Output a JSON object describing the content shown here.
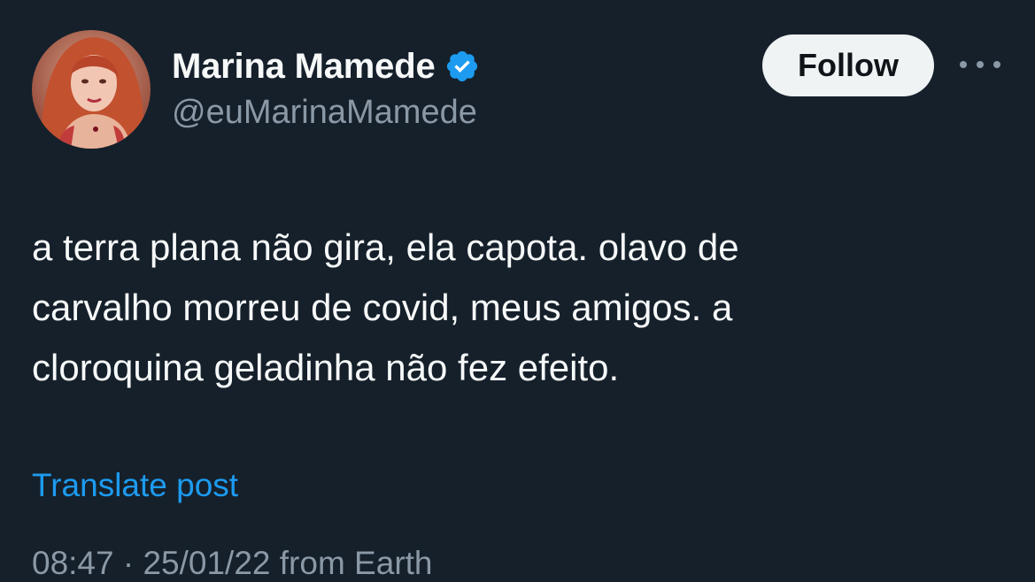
{
  "author": {
    "display_name": "Marina Mamede",
    "handle": "@euMarinaMamede",
    "verified": true,
    "avatar_icon": "profile-photo"
  },
  "actions": {
    "follow_label": "Follow",
    "more_icon": "more-horizontal-icon"
  },
  "tweet": {
    "text": "a terra plana não gira, ela capota. olavo de\ncarvalho morreu de covid, meus amigos. a\ncloroquina geladinha não fez efeito.",
    "translate_label": "Translate post",
    "meta": "08:47 · 25/01/22 from Earth"
  },
  "colors": {
    "background": "#15202b",
    "text_primary": "#f7f9f9",
    "text_secondary": "#8b98a5",
    "accent": "#1d9bf0",
    "follow_button_bg": "#eff3f4"
  }
}
